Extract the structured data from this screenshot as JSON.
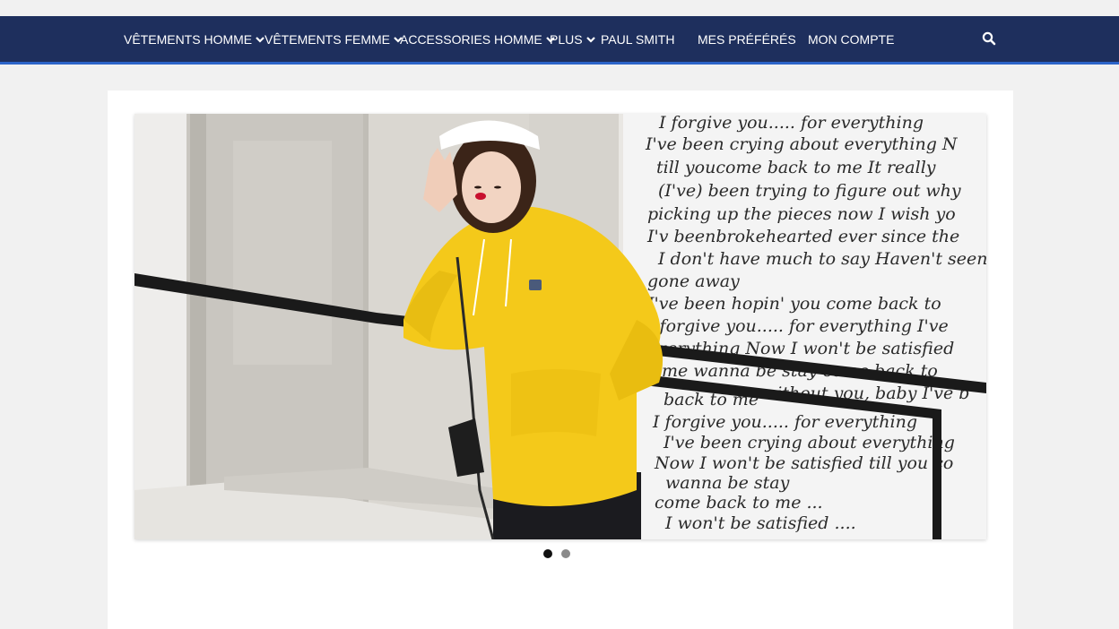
{
  "nav": {
    "items": [
      {
        "label": "VÊTEMENTS HOMME",
        "dropdown": true
      },
      {
        "label": "VÊTEMENTS FEMME",
        "dropdown": true
      },
      {
        "label": "ACCESSORIES HOMME",
        "dropdown": true
      },
      {
        "label": "PLUS",
        "dropdown": true
      },
      {
        "label": "PAUL SMITH",
        "dropdown": false
      },
      {
        "label": "MES PRÉFÉRÉS",
        "dropdown": false
      },
      {
        "label": "MON COMPTE",
        "dropdown": false
      }
    ],
    "search_icon": "search-icon",
    "colors": {
      "bar": "#1e2f5d",
      "accent": "#2c64c8",
      "text": "#ffffff"
    }
  },
  "slider": {
    "current": 1,
    "total": 2,
    "image_text_lines": [
      "I forgive you..... for everything",
      "I've been crying about everything N",
      "till youcome back to me It really",
      "(I've) been trying to figure out why",
      "picking up the pieces now I wish yo",
      "I'v beenbrokehearted ever since the",
      "I don't have much to say Haven't seen",
      "gone away",
      "I've been hopin' you come back to",
      "I forgive you..... for everything I've",
      "everything Now I won't be satisfied",
      "me wanna be stay come back to",
      "without you, baby I've b",
      "back to me",
      "I forgive you..... for everything",
      "I've been crying about everything",
      "Now I won't be satisfied till you co",
      "wanna be stay",
      "come back to me ...",
      "I won't be satisfied ...."
    ]
  }
}
